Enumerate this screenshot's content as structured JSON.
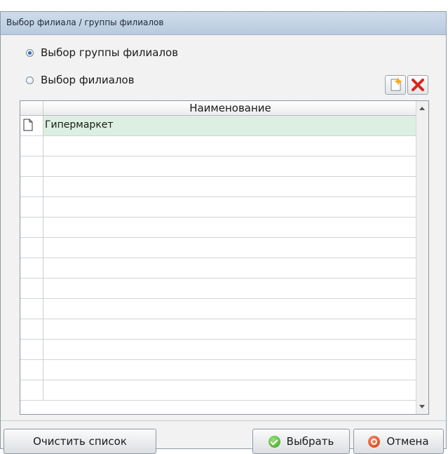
{
  "window": {
    "title": "Выбор филиала / группы филиалов"
  },
  "mode": {
    "options": [
      {
        "label": "Выбор группы филиалов",
        "selected": true
      },
      {
        "label": "Выбор филиалов",
        "selected": false
      }
    ]
  },
  "toolbar": {
    "add_icon": "new-item-icon",
    "delete_icon": "delete-icon"
  },
  "grid": {
    "column_header": "Наименование",
    "rows": [
      {
        "name": "Гипермаркет",
        "icon": "document-icon",
        "selected": true
      },
      {
        "name": ""
      },
      {
        "name": ""
      },
      {
        "name": ""
      },
      {
        "name": ""
      },
      {
        "name": ""
      },
      {
        "name": ""
      },
      {
        "name": ""
      },
      {
        "name": ""
      },
      {
        "name": ""
      },
      {
        "name": ""
      },
      {
        "name": ""
      },
      {
        "name": ""
      },
      {
        "name": ""
      }
    ]
  },
  "footer": {
    "clear_label": "Очистить список",
    "select_label": "Выбрать",
    "cancel_label": "Отмена"
  },
  "colors": {
    "selected_row": "#dcefe2",
    "titlebar": "#c5d5e8",
    "delete": "#d6281d"
  }
}
